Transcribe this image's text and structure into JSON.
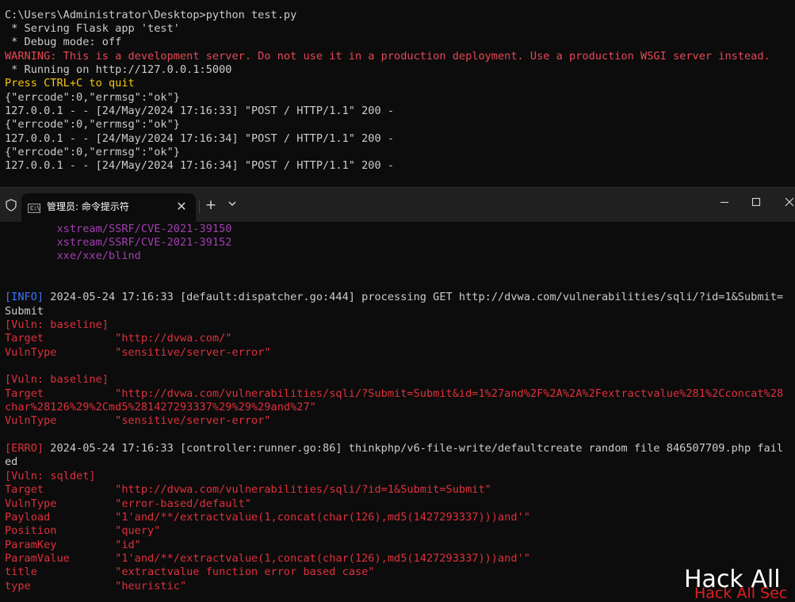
{
  "top_terminal": {
    "lines": [
      {
        "text": "C:\\Users\\Administrator\\Desktop>python test.py",
        "color": "white"
      },
      {
        "text": " * Serving Flask app 'test'",
        "color": "white"
      },
      {
        "text": " * Debug mode: off",
        "color": "white"
      },
      {
        "text": "WARNING: This is a development server. Do not use it in a production deployment. Use a production WSGI server instead.",
        "color": "red"
      },
      {
        "text": " * Running on http://127.0.0.1:5000",
        "color": "white"
      },
      {
        "text": "Press CTRL+C to quit",
        "color": "yellow"
      },
      {
        "text": "{\"errcode\":0,\"errmsg\":\"ok\"}",
        "color": "white"
      },
      {
        "text": "127.0.0.1 - - [24/May/2024 17:16:33] \"POST / HTTP/1.1\" 200 -",
        "color": "white"
      },
      {
        "text": "{\"errcode\":0,\"errmsg\":\"ok\"}",
        "color": "white"
      },
      {
        "text": "127.0.0.1 - - [24/May/2024 17:16:34] \"POST / HTTP/1.1\" 200 -",
        "color": "white"
      },
      {
        "text": "{\"errcode\":0,\"errmsg\":\"ok\"}",
        "color": "white"
      },
      {
        "text": "127.0.0.1 - - [24/May/2024 17:16:34] \"POST / HTTP/1.1\" 200 -",
        "color": "white"
      }
    ]
  },
  "window": {
    "tab_title": "管理员: 命令提示符",
    "tab_icon_text": "C:\\",
    "close_tab": "✕",
    "new_tab": "+",
    "dropdown": "⌄",
    "minimize": "—",
    "maximize": "☐",
    "close_window": "✕"
  },
  "console": {
    "lines": [
      {
        "segments": [
          {
            "text": "        xstream/SSRF/CVE-2021-39150",
            "color": "purple"
          }
        ]
      },
      {
        "segments": [
          {
            "text": "        xstream/SSRF/CVE-2021-39152",
            "color": "purple"
          }
        ]
      },
      {
        "segments": [
          {
            "text": "        xxe/xxe/blind",
            "color": "purple"
          }
        ]
      },
      {
        "segments": [
          {
            "text": "",
            "color": "white"
          }
        ]
      },
      {
        "segments": [
          {
            "text": "",
            "color": "white"
          }
        ]
      },
      {
        "segments": [
          {
            "text": "[INFO]",
            "color": "blue"
          },
          {
            "text": " 2024-05-24 17:16:33 [default:dispatcher.go:444] processing GET http://dvwa.com/vulnerabilities/sqli/?id=1&Submit=",
            "color": "white"
          }
        ]
      },
      {
        "segments": [
          {
            "text": "Submit",
            "color": "white"
          }
        ]
      },
      {
        "segments": [
          {
            "text": "[Vuln: baseline]",
            "color": "redl"
          }
        ]
      },
      {
        "segments": [
          {
            "text": "Target           \"http://dvwa.com/\"",
            "color": "redl"
          }
        ]
      },
      {
        "segments": [
          {
            "text": "VulnType         \"sensitive/server-error\"",
            "color": "redl"
          }
        ]
      },
      {
        "segments": [
          {
            "text": "",
            "color": "white"
          }
        ]
      },
      {
        "segments": [
          {
            "text": "[Vuln: baseline]",
            "color": "redl"
          }
        ]
      },
      {
        "segments": [
          {
            "text": "Target           \"http://dvwa.com/vulnerabilities/sqli/?Submit=Submit&id=1%27and%2F%2A%2A%2Fextractvalue%281%2Cconcat%28",
            "color": "redl"
          }
        ]
      },
      {
        "segments": [
          {
            "text": "char%28126%29%2Cmd5%281427293337%29%29%29and%27\"",
            "color": "redl"
          }
        ]
      },
      {
        "segments": [
          {
            "text": "VulnType         \"sensitive/server-error\"",
            "color": "redl"
          }
        ]
      },
      {
        "segments": [
          {
            "text": "",
            "color": "white"
          }
        ]
      },
      {
        "segments": [
          {
            "text": "[ERRO]",
            "color": "redl"
          },
          {
            "text": " 2024-05-24 17:16:33 [controller:runner.go:86] thinkphp/v6-file-write/defaultcreate random file 846507709.php fail",
            "color": "white"
          }
        ]
      },
      {
        "segments": [
          {
            "text": "ed",
            "color": "white"
          }
        ]
      },
      {
        "segments": [
          {
            "text": "[Vuln: sqldet]",
            "color": "redl"
          }
        ]
      },
      {
        "segments": [
          {
            "text": "Target           \"http://dvwa.com/vulnerabilities/sqli/?id=1&Submit=Submit\"",
            "color": "redl"
          }
        ]
      },
      {
        "segments": [
          {
            "text": "VulnType         \"error-based/default\"",
            "color": "redl"
          }
        ]
      },
      {
        "segments": [
          {
            "text": "Payload          \"1'and/**/extractvalue(1,concat(char(126),md5(1427293337)))and'\"",
            "color": "redl"
          }
        ]
      },
      {
        "segments": [
          {
            "text": "Position         \"query\"",
            "color": "redl"
          }
        ]
      },
      {
        "segments": [
          {
            "text": "ParamKey         \"id\"",
            "color": "redl"
          }
        ]
      },
      {
        "segments": [
          {
            "text": "ParamValue       \"1'and/**/extractvalue(1,concat(char(126),md5(1427293337)))and'\"",
            "color": "redl"
          }
        ]
      },
      {
        "segments": [
          {
            "text": "title            \"extractvalue function error based case\"",
            "color": "redl"
          }
        ]
      },
      {
        "segments": [
          {
            "text": "type             \"heuristic\"",
            "color": "redl"
          }
        ]
      }
    ]
  },
  "watermark": {
    "primary": "Hack All",
    "secondary": "Hack All Sec"
  },
  "colors": {
    "white": "#cccccc",
    "red": "#e74856",
    "yellow": "#f9c80e",
    "purple": "#a23fb0",
    "blue": "#3b78ff",
    "redl": "#e0303c"
  }
}
